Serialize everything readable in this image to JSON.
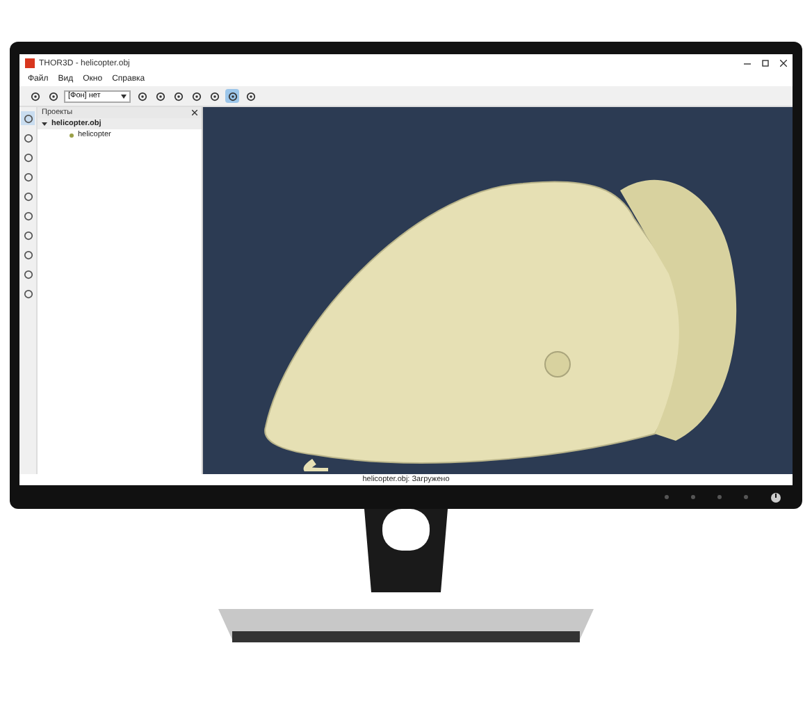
{
  "window": {
    "title": "THOR3D - helicopter.obj"
  },
  "menu": [
    "Файл",
    "Вид",
    "Окно",
    "Справка"
  ],
  "toolbar": {
    "buttons_left": [
      {
        "selected": false
      },
      {
        "selected": false
      }
    ],
    "combo": {
      "value": "[Фон] нет"
    },
    "buttons_right": [
      {
        "selected": false
      },
      {
        "selected": false
      },
      {
        "selected": false
      },
      {
        "selected": false
      },
      {
        "selected": false
      },
      {
        "selected": true
      },
      {
        "selected": false
      }
    ]
  },
  "tools": [
    {
      "selected": true
    },
    {
      "selected": false
    },
    {
      "selected": false
    },
    {
      "selected": false
    },
    {
      "selected": false
    },
    {
      "selected": false
    },
    {
      "selected": false
    },
    {
      "selected": false
    },
    {
      "selected": false
    },
    {
      "selected": false
    }
  ],
  "panel": {
    "title": "Проекты",
    "tree": [
      {
        "label": "helicopter.obj",
        "expanded": true,
        "children": [
          {
            "label": "helicopter"
          }
        ]
      }
    ]
  },
  "status_bar": "helicopter.obj: Загружено"
}
